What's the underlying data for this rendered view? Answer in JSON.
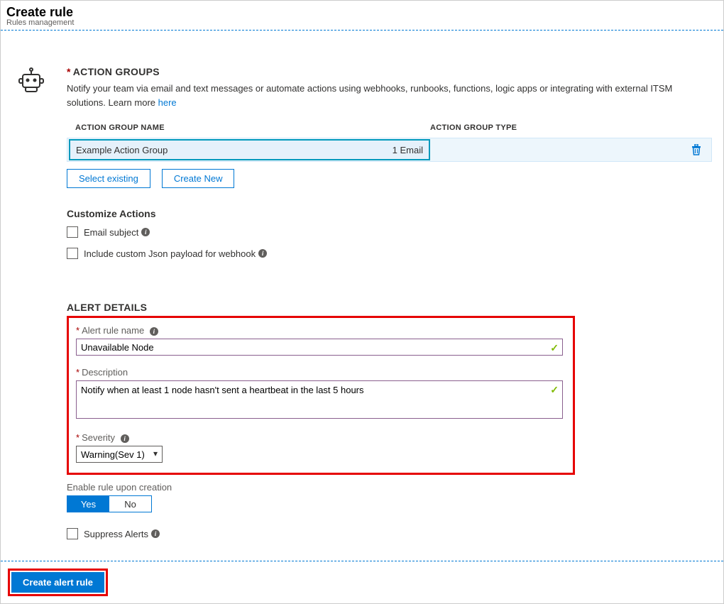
{
  "header": {
    "title": "Create rule",
    "subtitle": "Rules management"
  },
  "action_groups": {
    "title": "ACTION GROUPS",
    "description": "Notify your team via email and text messages or automate actions using webhooks, runbooks, functions, logic apps or integrating with external ITSM solutions. Learn more ",
    "learn_more": "here",
    "col_name": "ACTION GROUP NAME",
    "col_type": "ACTION GROUP TYPE",
    "row": {
      "name": "Example Action Group",
      "type": "1 Email"
    },
    "select_existing": "Select existing",
    "create_new": "Create New"
  },
  "customize": {
    "title": "Customize Actions",
    "email_subject": "Email subject",
    "json_payload": "Include custom Json payload for webhook"
  },
  "alert_details": {
    "title": "ALERT DETAILS",
    "name_label": "Alert rule name",
    "name_value": "Unavailable Node",
    "description_label": "Description",
    "description_value": "Notify when at least 1 node hasn't sent a heartbeat in the last 5 hours",
    "severity_label": "Severity",
    "severity_value": "Warning(Sev 1)",
    "enable_label": "Enable rule upon creation",
    "yes": "Yes",
    "no": "No",
    "suppress": "Suppress Alerts"
  },
  "footer": {
    "create_button": "Create alert rule"
  }
}
